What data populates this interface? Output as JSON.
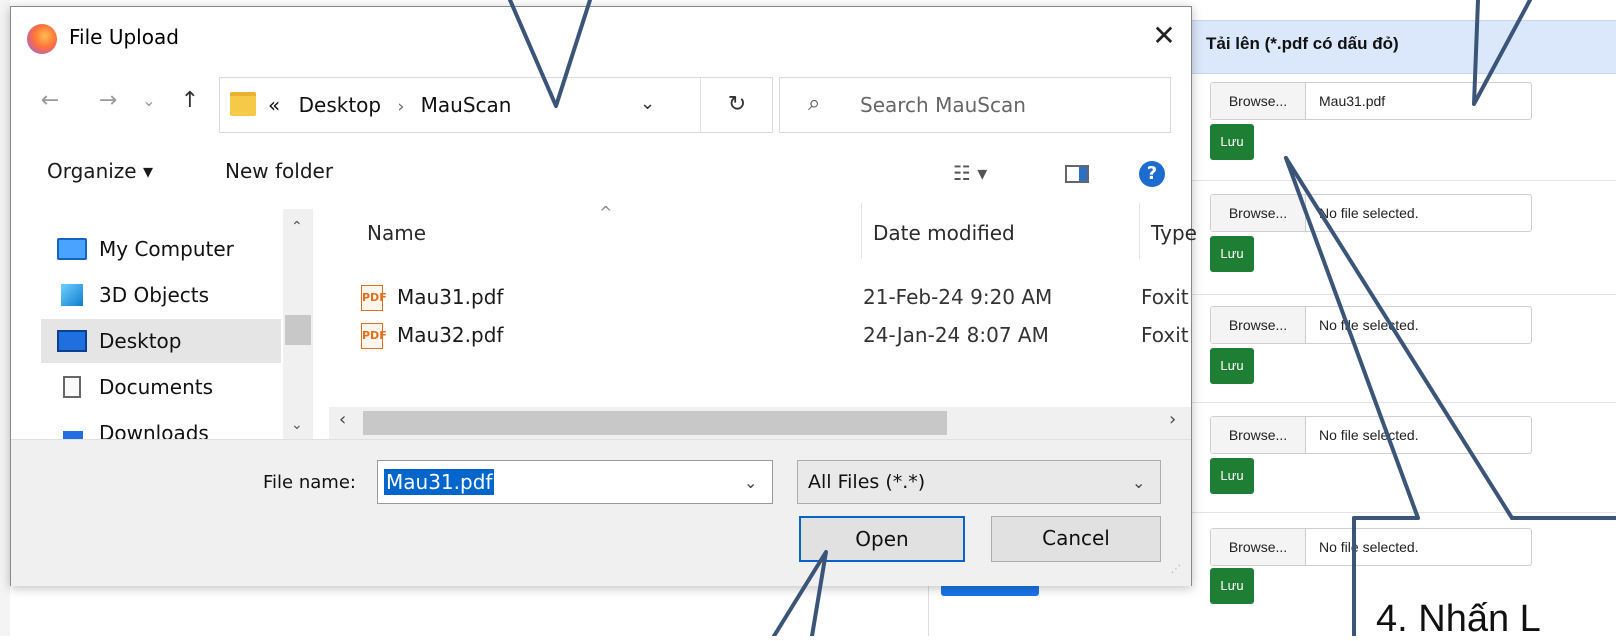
{
  "dialog": {
    "title": "File Upload",
    "close_glyph": "✕",
    "nav": {
      "back": "←",
      "forward": "→",
      "recent": "⌄",
      "up": "↑"
    },
    "address": {
      "prefix": "«",
      "crumbs": [
        "Desktop",
        "MauScan"
      ],
      "separator": "›",
      "dropdown": "⌄",
      "refresh": "↻"
    },
    "search": {
      "placeholder": "Search MauScan",
      "icon": "search-icon"
    },
    "toolbar": {
      "organize": "Organize ▾",
      "new_folder": "New folder",
      "view_glyph": "☷ ▾",
      "help": "?"
    },
    "nav_pane": {
      "items": [
        {
          "label": "My Computer",
          "icon": "computer-icon"
        },
        {
          "label": "3D Objects",
          "icon": "cube-icon"
        },
        {
          "label": "Desktop",
          "icon": "desktop-icon",
          "selected": true
        },
        {
          "label": "Documents",
          "icon": "document-icon"
        },
        {
          "label": "Downloads",
          "icon": "download-icon"
        }
      ]
    },
    "file_list": {
      "columns": [
        "Name",
        "Date modified",
        "Type"
      ],
      "rows": [
        {
          "name": "Mau31.pdf",
          "date": "21-Feb-24 9:20 AM",
          "type": "Foxit"
        },
        {
          "name": "Mau32.pdf",
          "date": "24-Jan-24 8:07 AM",
          "type": "Foxit"
        }
      ]
    },
    "file_name_label": "File name:",
    "file_name_value": "Mau31.pdf",
    "file_type": "All Files (*.*)",
    "open_label": "Open",
    "cancel_label": "Cancel"
  },
  "panel": {
    "title": "Tải lên (*.pdf có dấu đỏ)",
    "rows": [
      {
        "browse": "Browse...",
        "file": "Mau31.pdf",
        "save": "Lưu"
      },
      {
        "browse": "Browse...",
        "file": "No file selected.",
        "save": "Lưu"
      },
      {
        "browse": "Browse...",
        "file": "No file selected.",
        "save": "Lưu"
      },
      {
        "browse": "Browse...",
        "file": "No file selected.",
        "save": "Lưu"
      },
      {
        "browse": "Browse...",
        "file": "No file selected.",
        "save": "Lưu"
      }
    ]
  },
  "annotation": {
    "text": "4. Nhấn L"
  },
  "colors": {
    "accent": "#1e7e34",
    "header": "#dbe7fb",
    "selection": "#0066cc",
    "annotation_line": "#3a5578"
  }
}
